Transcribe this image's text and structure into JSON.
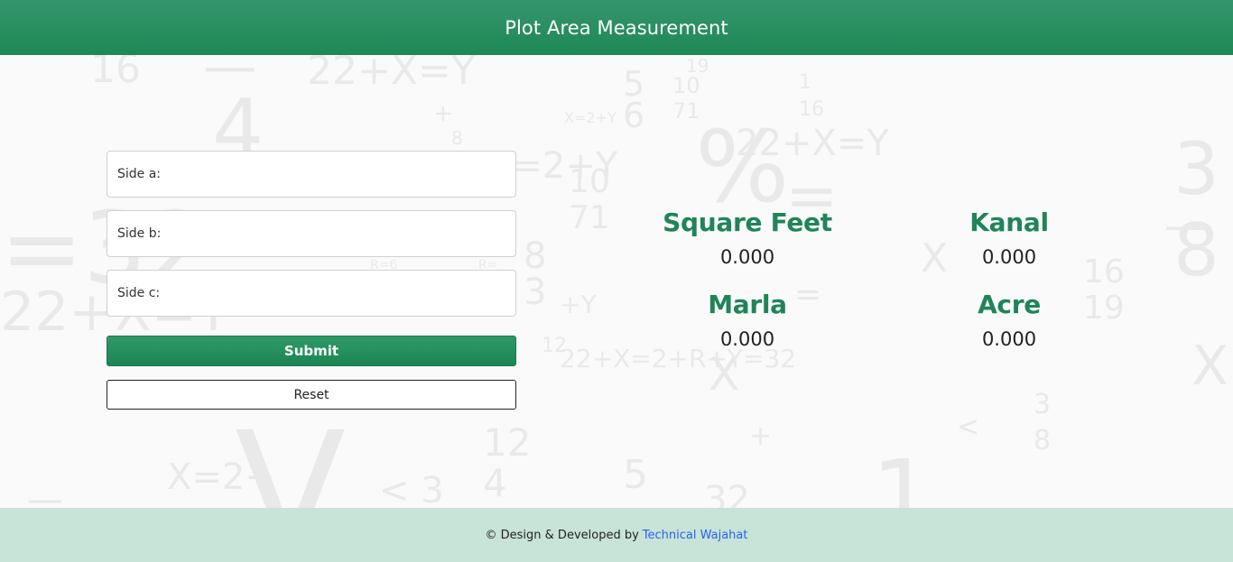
{
  "header": {
    "title": "Plot Area Measurement"
  },
  "form": {
    "side_a_label": "Side a:",
    "side_b_label": "Side b:",
    "side_c_label": "Side c:",
    "side_a_value": "",
    "side_b_value": "",
    "side_c_value": "",
    "submit_label": "Submit",
    "reset_label": "Reset"
  },
  "results": {
    "square_feet": {
      "title": "Square Feet",
      "value": "0.000"
    },
    "kanal": {
      "title": "Kanal",
      "value": "0.000"
    },
    "marla": {
      "title": "Marla",
      "value": "0.000"
    },
    "acre": {
      "title": "Acre",
      "value": "0.000"
    }
  },
  "footer": {
    "text": "© Design & Developed by",
    "link_text": "Technical Wajahat"
  },
  "colors": {
    "header_green": "#1d8855",
    "result_title_green": "#1f8556",
    "footer_bg": "#c8e3d8",
    "link_blue": "#2563eb"
  }
}
